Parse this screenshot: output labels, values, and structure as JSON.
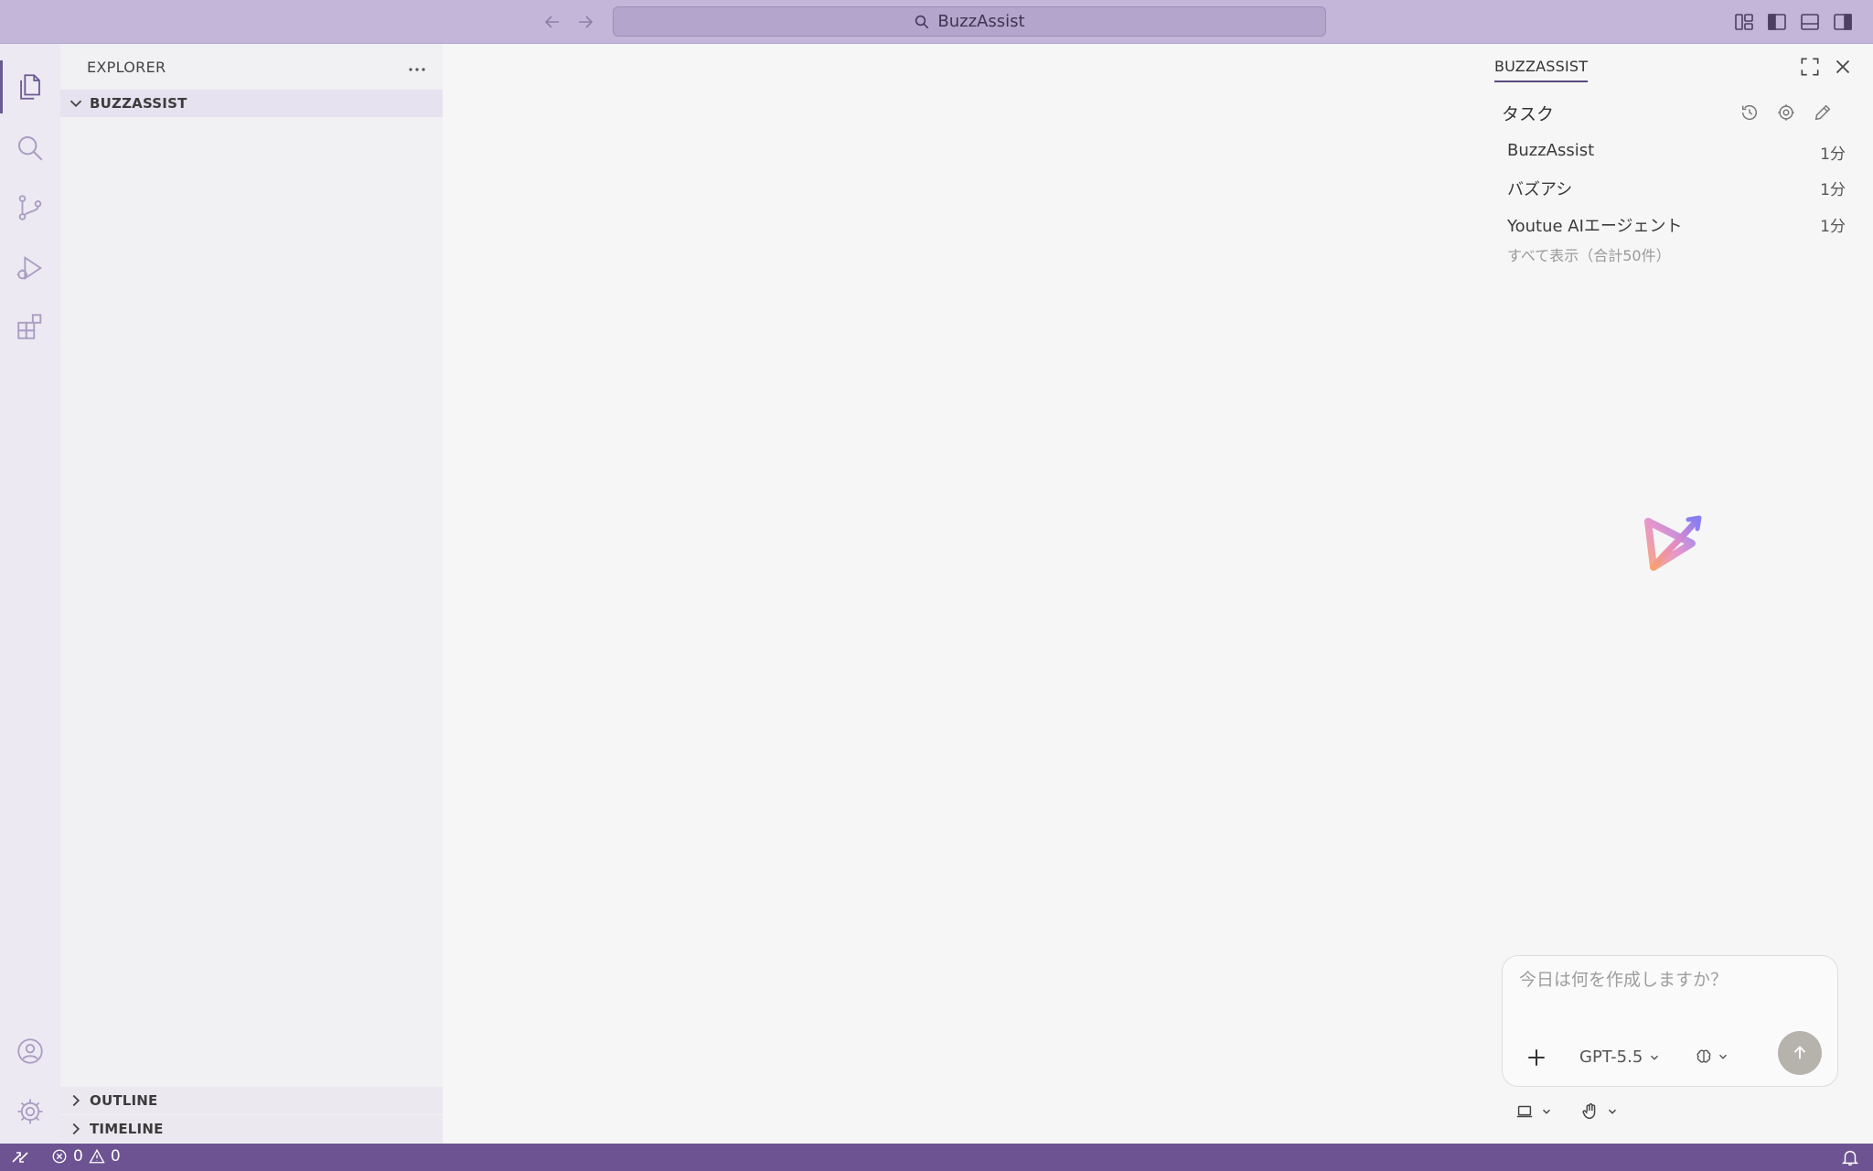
{
  "titlebar": {
    "search_text": "BuzzAssist"
  },
  "activity": {
    "items": [
      "explorer-icon",
      "search-icon",
      "source-control-icon",
      "run-debug-icon",
      "extensions-icon"
    ],
    "bottom": [
      "account-icon",
      "settings-gear-icon"
    ]
  },
  "explorer": {
    "title": "EXPLORER",
    "folder": "BUZZASSIST",
    "outline": "OUTLINE",
    "timeline": "TIMELINE"
  },
  "assistant": {
    "tab": "BUZZASSIST",
    "tasks_label": "タスク",
    "tasks": [
      {
        "title": "BuzzAssist",
        "time": "1分"
      },
      {
        "title": "バズアシ",
        "time": "1分"
      },
      {
        "title": "Youtue AIエージェント",
        "time": "1分"
      }
    ],
    "show_all": "すべて表示（合計50件）",
    "composer": {
      "placeholder": "今日は何を作成しますか？",
      "model": "GPT-5.5"
    }
  },
  "statusbar": {
    "errors": "0",
    "warnings": "0"
  },
  "colors": {
    "titlebar": "#c3b6d9",
    "statusbar": "#6d5392",
    "accent": "#6b5b91"
  }
}
